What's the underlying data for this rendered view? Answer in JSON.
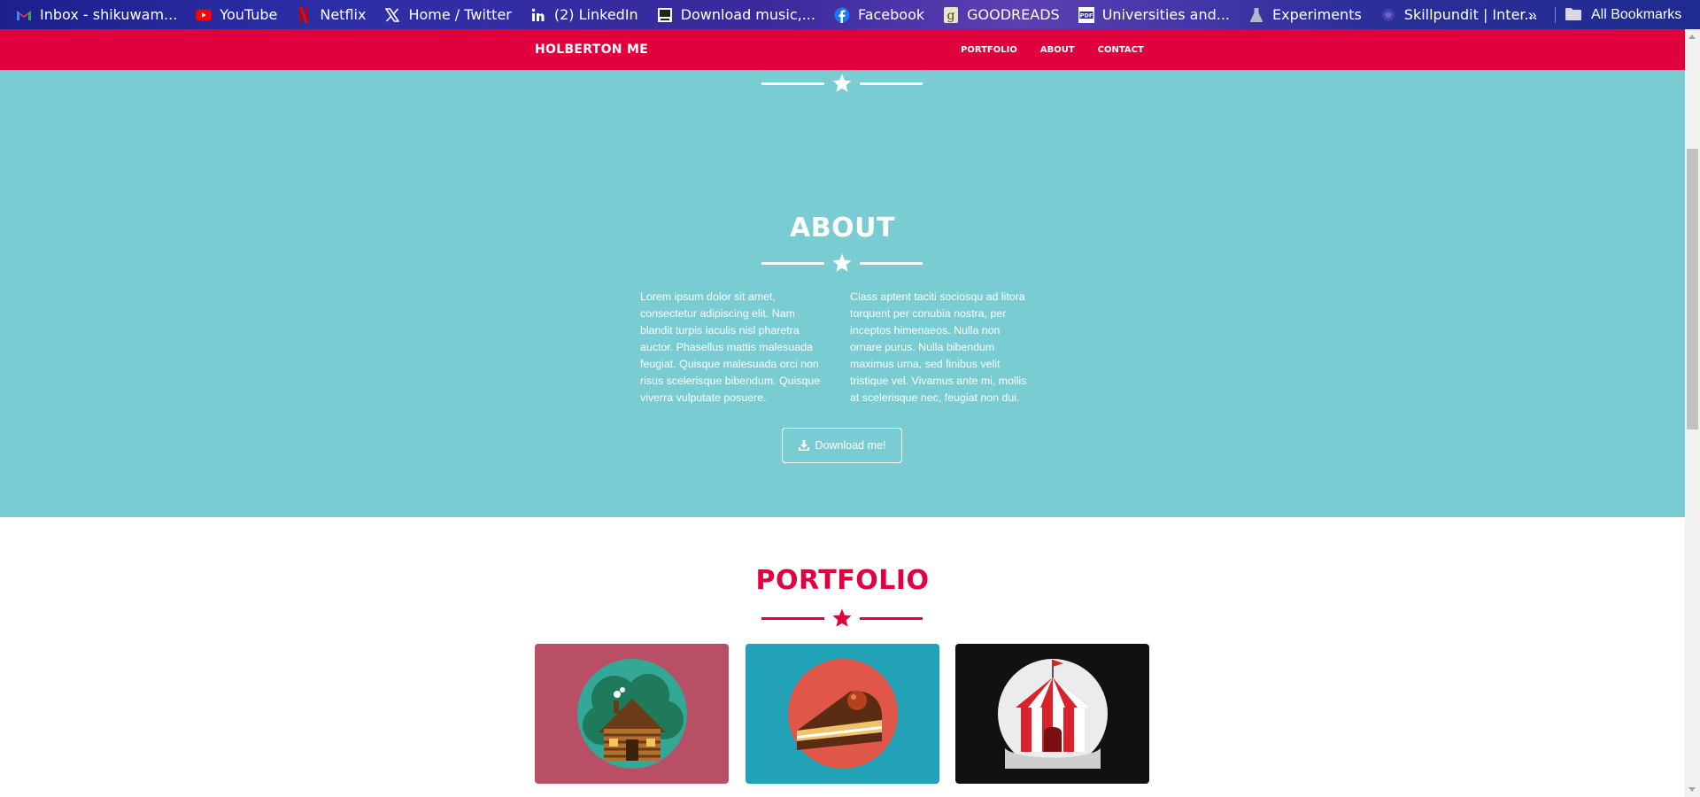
{
  "bookmarks": {
    "items": [
      {
        "label": "Inbox - shikuwam...",
        "icon": "gmail-icon"
      },
      {
        "label": "YouTube",
        "icon": "youtube-icon"
      },
      {
        "label": "Netflix",
        "icon": "netflix-icon"
      },
      {
        "label": "Home / Twitter",
        "icon": "x-twitter-icon"
      },
      {
        "label": "(2) LinkedIn",
        "icon": "linkedin-icon"
      },
      {
        "label": "Download music,...",
        "icon": "download-site-icon"
      },
      {
        "label": "Facebook",
        "icon": "facebook-icon"
      },
      {
        "label": "GOODREADS",
        "icon": "goodreads-icon"
      },
      {
        "label": "Universities and...",
        "icon": "pdf-icon"
      },
      {
        "label": "Experiments",
        "icon": "flask-icon"
      },
      {
        "label": "Skillpundit | Inter...",
        "icon": "skillpundit-icon"
      }
    ],
    "more_label": "»",
    "all_label": "All Bookmarks"
  },
  "navbar": {
    "brand": "HOLBERTON ME",
    "links": [
      "PORTFOLIO",
      "ABOUT",
      "CONTACT"
    ]
  },
  "about": {
    "title": "ABOUT",
    "col1": "Lorem ipsum dolor sit amet, consectetur adipiscing elit. Nam blandit turpis iaculis nisl pharetra auctor. Phasellus mattis malesuada feugiat. Quisque malesuada orci non risus scelerisque bibendum. Quisque viverra vulputate posuere.",
    "col2": "Class aptent taciti sociosqu ad litora torquent per conubia nostra, per inceptos himenaeos. Nulla non ornare purus. Nulla bibendum maximus urna, sed finibus velit tristique vel. Vivamus ante mi, mollis at scelerisque nec, feugiat non dui.",
    "button": "Download me!"
  },
  "portfolio": {
    "title": "PORTFOLIO",
    "items": [
      {
        "name": "cabin",
        "bg": "#b84f65"
      },
      {
        "name": "cake",
        "bg": "#22a2b6"
      },
      {
        "name": "circus",
        "bg": "#131110"
      }
    ]
  },
  "colors": {
    "accent": "#e1003d",
    "about_bg": "#79cdd2",
    "white": "#ffffff"
  }
}
